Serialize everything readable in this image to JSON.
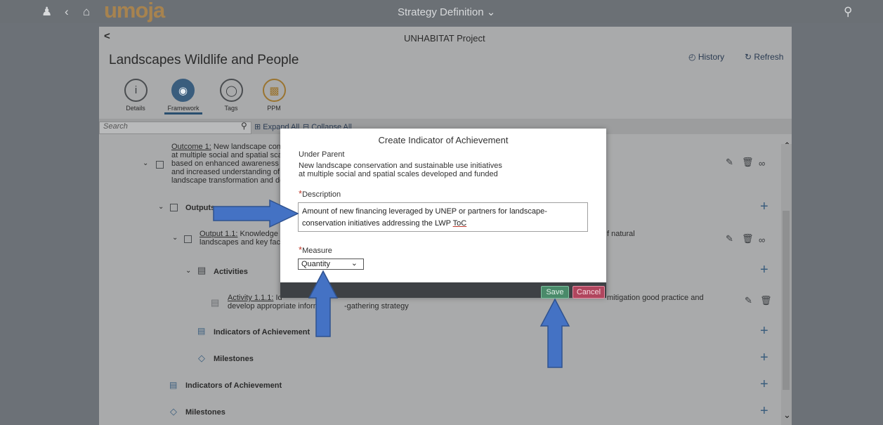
{
  "shell": {
    "logo": "umoja",
    "app_title": "Strategy Definition",
    "subtitle": "UNHABITAT Project"
  },
  "object": {
    "title": "Landscapes Wildlife and People",
    "history": "History",
    "refresh": "Refresh"
  },
  "tabs": [
    {
      "label": "Details",
      "icon": "info-icon"
    },
    {
      "label": "Framework",
      "icon": "target-icon"
    },
    {
      "label": "Tags",
      "icon": "tag-icon"
    },
    {
      "label": "PPM",
      "icon": "ppm-icon"
    }
  ],
  "toolbar": {
    "search_placeholder": "Search",
    "expand_all": "Expand All",
    "collapse_all": "Collapse All"
  },
  "tree": {
    "outcome_link": "Outcome 1:",
    "outcome_lines": [
      "New landscape con",
      "at multiple social and spatial sca",
      "based on enhanced awareness a",
      "and increased understanding of",
      "landscape transformation and de"
    ],
    "outputs": "Outputs",
    "output_link": "Output 1.1:",
    "output_line1": "Knowledge",
    "output_line2": "landscapes and key fact",
    "output_tail": "f natural",
    "activities": "Activities",
    "activity_link": "Activity 1.1.1:",
    "activity_line1": "Id",
    "activity_line2": "develop appropriate informa",
    "activity_line2b": "-gathering strategy",
    "activity_tail": "mitigation good practice and",
    "indicators_inner": "Indicators of Achievement",
    "milestones_inner": "Milestones",
    "indicators_outer": "Indicators of Achievement",
    "milestones_outer": "Milestones"
  },
  "dialog": {
    "title": "Create Indicator of Achievement",
    "under_parent_label": "Under Parent",
    "under_parent_line1": "New landscape conservation and sustainable use initiatives",
    "under_parent_line2": "at multiple social and spatial scales developed and funded",
    "description_label": "Description",
    "description_line1": "Amount of new financing leveraged by UNEP or partners for landscape-",
    "description_line2": "conservation initiatives addressing the LWP ",
    "description_toc": "ToC",
    "measure_label": "Measure",
    "measure_value": "Quantity",
    "save": "Save",
    "cancel": "Cancel",
    "required_mark": "*"
  },
  "colors": {
    "arrow": "#4472c4",
    "accent": "#3a5d7d",
    "save": "#4a8a6a",
    "cancel": "#b0465e"
  }
}
